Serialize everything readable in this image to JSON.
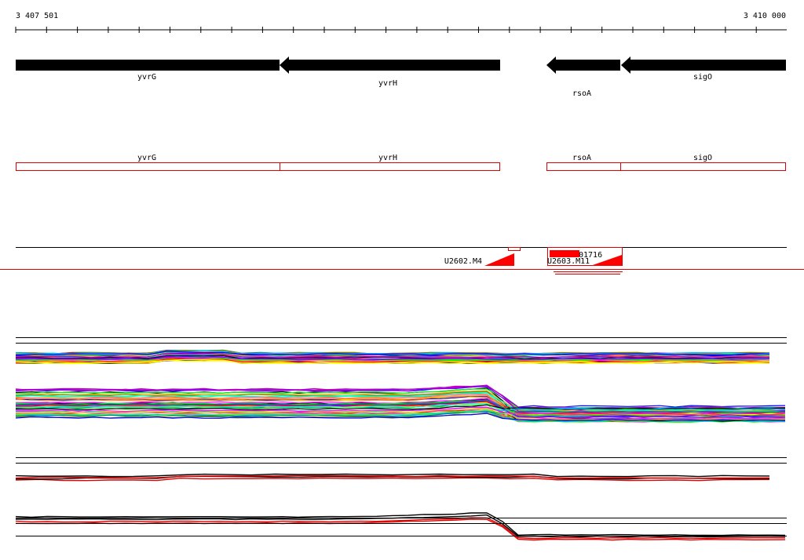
{
  "ruler": {
    "start_label": "3 407 501",
    "end_label": "3 410 000"
  },
  "genes": [
    {
      "name": "yvrG",
      "strand": "-"
    },
    {
      "name": "yvrH",
      "strand": "-"
    },
    {
      "name": "rsoA",
      "strand": "-"
    },
    {
      "name": "sigO",
      "strand": "-"
    }
  ],
  "annotation_boxes": [
    {
      "name": "yvrG"
    },
    {
      "name": "yvrH"
    },
    {
      "name": "rsoA"
    },
    {
      "name": "sigO"
    }
  ],
  "features": [
    {
      "label": "U2602.M4"
    },
    {
      "label": "U2603.M11"
    },
    {
      "label": "01716"
    }
  ],
  "colors": {
    "gene_arrow": "#000000",
    "annotation_box": "#e00000",
    "feature": "#ff0000",
    "track_line": "#000000"
  }
}
